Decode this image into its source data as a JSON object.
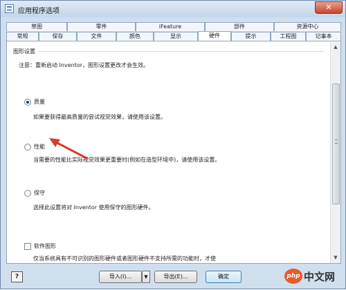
{
  "window": {
    "title": "应用程序选项",
    "close_label": "✕"
  },
  "tabs": {
    "row1": [
      {
        "label": "草图"
      },
      {
        "label": "零件"
      },
      {
        "label": "iFeature"
      },
      {
        "label": "部件"
      },
      {
        "label": "资源中心"
      }
    ],
    "row2": [
      {
        "label": "常规"
      },
      {
        "label": "保存"
      },
      {
        "label": "文件"
      },
      {
        "label": "颜色"
      },
      {
        "label": "显示"
      },
      {
        "label": "硬件",
        "active": true
      },
      {
        "label": "提示"
      },
      {
        "label": "工程图"
      },
      {
        "label": "记事本"
      }
    ]
  },
  "panel": {
    "group_title": "图形设置",
    "note": "注意：重新启动 Inventor，图形设置更改才会生效。",
    "options": [
      {
        "label": "质量",
        "desc": "如果要获得最高质量的尝试视觉效果，请使用该设置。",
        "checked": true
      },
      {
        "label": "性能",
        "desc": "当需要的性能比实际视觉效果更重要时(例如在造型环境中)，请使用该设置。",
        "checked": false
      },
      {
        "label": "保守",
        "desc": "选择此设置将对 Inventor 使用保守的图形硬件。",
        "checked": false
      }
    ],
    "software_label": "软件图形",
    "software_desc": "仅当系统具有不可识别的图形硬件或者图形硬件不支持所需的功能时，才使"
  },
  "footer": {
    "help": "?",
    "import_label": "导入(I)...",
    "export_label": "导出(E)...",
    "ok_label": "确定"
  },
  "watermark": {
    "php": "php",
    "text": "中文网"
  },
  "colors": {
    "annotation_arrow": "#d93a2b",
    "window_frame": "#cfdfee"
  }
}
